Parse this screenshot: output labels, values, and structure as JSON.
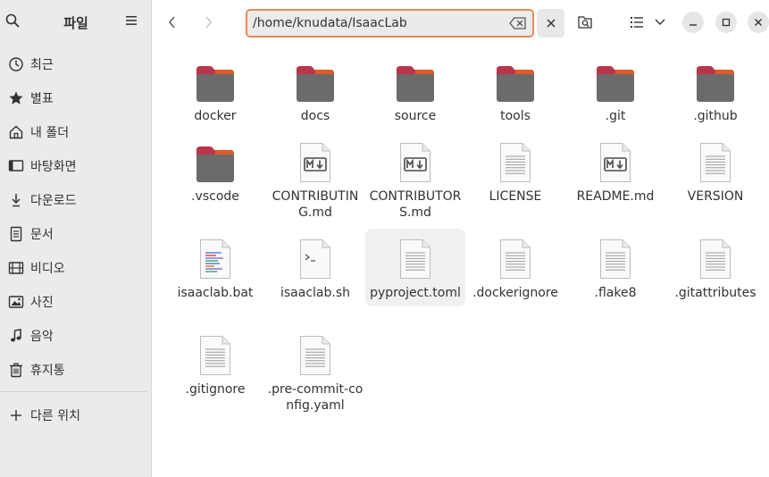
{
  "sidebar": {
    "title": "파일",
    "items": [
      {
        "label": "최근",
        "icon": "clock-icon"
      },
      {
        "label": "별표",
        "icon": "star-icon"
      },
      {
        "label": "내 폴더",
        "icon": "home-icon"
      },
      {
        "label": "바탕화면",
        "icon": "desktop-icon"
      },
      {
        "label": "다운로드",
        "icon": "download-icon"
      },
      {
        "label": "문서",
        "icon": "document-icon"
      },
      {
        "label": "비디오",
        "icon": "video-icon"
      },
      {
        "label": "사진",
        "icon": "photo-icon"
      },
      {
        "label": "음악",
        "icon": "music-icon"
      },
      {
        "label": "휴지통",
        "icon": "trash-icon"
      }
    ],
    "other": {
      "label": "다른 위치",
      "icon": "plus-icon"
    }
  },
  "header": {
    "path": "/home/knudata/IsaacLab"
  },
  "files": [
    {
      "name": "docker",
      "type": "folder"
    },
    {
      "name": "docs",
      "type": "folder"
    },
    {
      "name": "source",
      "type": "folder"
    },
    {
      "name": "tools",
      "type": "folder"
    },
    {
      "name": ".git",
      "type": "folder"
    },
    {
      "name": ".github",
      "type": "folder"
    },
    {
      "name": ".vscode",
      "type": "folder"
    },
    {
      "name": "CONTRIBUTING.md",
      "type": "markdown"
    },
    {
      "name": "CONTRIBUTORS.md",
      "type": "markdown"
    },
    {
      "name": "LICENSE",
      "type": "text"
    },
    {
      "name": "README.md",
      "type": "markdown"
    },
    {
      "name": "VERSION",
      "type": "text"
    },
    {
      "name": "isaaclab.bat",
      "type": "code"
    },
    {
      "name": "isaaclab.sh",
      "type": "script"
    },
    {
      "name": "pyproject.toml",
      "type": "text"
    },
    {
      "name": ".dockerignore",
      "type": "text"
    },
    {
      "name": ".flake8",
      "type": "text"
    },
    {
      "name": ".gitattributes",
      "type": "text"
    },
    {
      "name": ".gitignore",
      "type": "text"
    },
    {
      "name": ".pre-commit-config.yaml",
      "type": "text"
    }
  ],
  "colors": {
    "folder_top": "#b9354a",
    "folder_accent": "#e05a2a",
    "folder_body": "#6b6b6b",
    "path_focus": "#e58b56"
  }
}
